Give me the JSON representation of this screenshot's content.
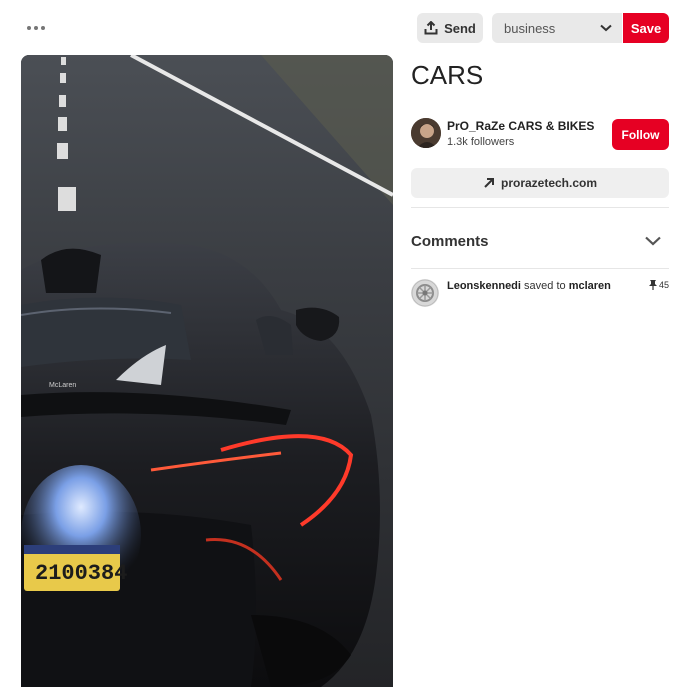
{
  "toolbar": {
    "more_icon": "ellipsis-icon",
    "send_label": "Send",
    "send_icon": "share-upload-icon",
    "board_selected": "business",
    "save_label": "Save"
  },
  "pin": {
    "title": "CARS",
    "image_alt": "Black sports car on road",
    "plate_text": "2100384"
  },
  "creator": {
    "name": "PrO_RaZe CARS & BIKES",
    "followers": "1.3k followers",
    "follow_label": "Follow"
  },
  "link": {
    "label": "prorazetech.com",
    "icon": "arrow-up-right-icon"
  },
  "comments": {
    "title": "Comments",
    "toggle_icon": "chevron-down-icon"
  },
  "activity": {
    "user": "Leonskennedi",
    "action": "saved to",
    "board": "mclaren",
    "save_count": "45"
  },
  "colors": {
    "accent": "#e60023",
    "button_gray": "#e9e9e9"
  }
}
